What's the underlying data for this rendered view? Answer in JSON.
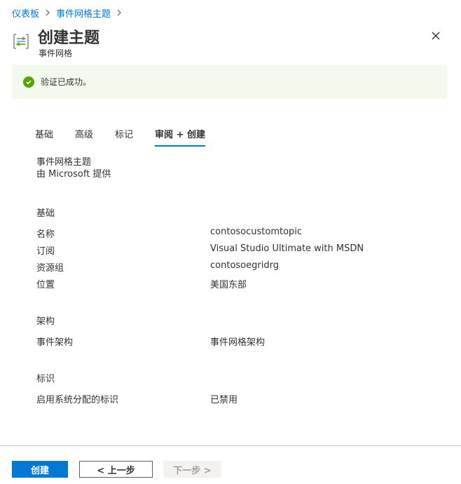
{
  "breadcrumb": {
    "items": [
      "仪表板",
      "事件网格主题"
    ],
    "separator": ">"
  },
  "header": {
    "title": "创建主题",
    "subtitle": "事件网格",
    "icon": "event-grid-topic-icon"
  },
  "validation": {
    "message": "验证已成功。",
    "status_color": "#57a300"
  },
  "tabs": [
    {
      "label": "基础",
      "active": false
    },
    {
      "label": "高级",
      "active": false
    },
    {
      "label": "标记",
      "active": false
    },
    {
      "label": "审阅 + 创建",
      "active": true
    }
  ],
  "product": {
    "name": "事件网格主题",
    "provider": "由 Microsoft 提供"
  },
  "sections": {
    "basics": {
      "title": "基础",
      "rows": [
        {
          "label": "名称",
          "value": "contosocustomtopic"
        },
        {
          "label": "订阅",
          "value": "Visual Studio Ultimate with MSDN"
        },
        {
          "label": "资源组",
          "value": "contosoegridrg"
        },
        {
          "label": "位置",
          "value": "美国东部"
        }
      ]
    },
    "schema": {
      "title": "架构",
      "rows": [
        {
          "label": "事件架构",
          "value": "事件网格架构"
        }
      ]
    },
    "identity": {
      "title": "标识",
      "rows": [
        {
          "label": "启用系统分配的标识",
          "value": "已禁用"
        }
      ]
    }
  },
  "footer": {
    "create_label": "创建",
    "prev_label": "< 上一步",
    "next_label": "下一步 >"
  },
  "colors": {
    "accent": "#0078d4",
    "success_bg": "#f3f9ec"
  }
}
